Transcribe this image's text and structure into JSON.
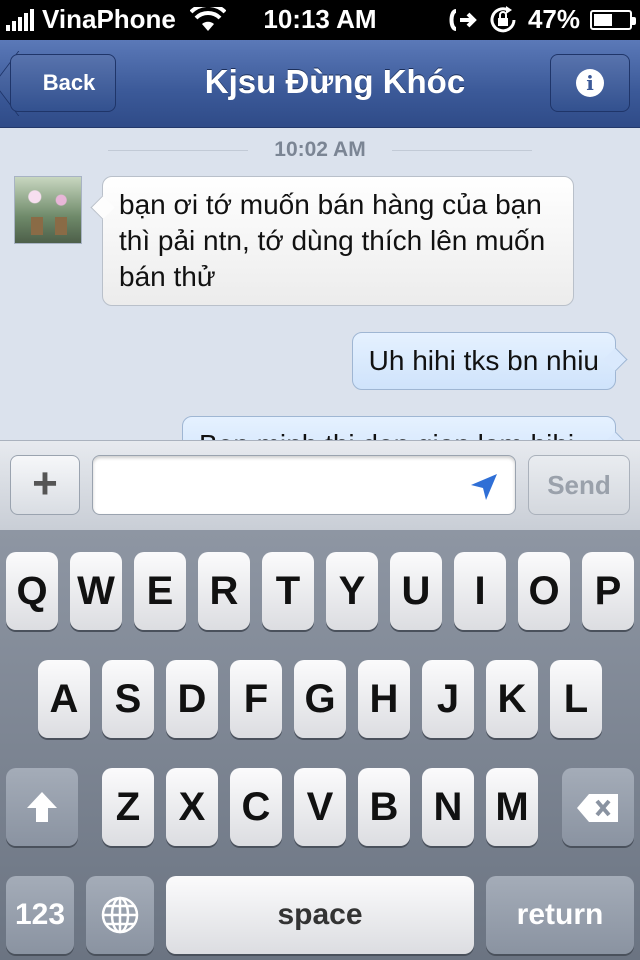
{
  "status_bar": {
    "carrier": "VinaPhone",
    "time": "10:13 AM",
    "battery_percent": "47%",
    "battery_level": 0.47,
    "icons": [
      "signal-icon",
      "wifi-icon",
      "call-forward-icon",
      "rotation-lock-icon",
      "battery-icon"
    ]
  },
  "nav": {
    "back_label": "Back",
    "title": "Kjsu Đừng Khóc",
    "info_icon": "info-icon"
  },
  "chat": {
    "timestamp": "10:02 AM",
    "messages": [
      {
        "direction": "incoming",
        "text": "bạn ơi tớ muốn bán hàng của bạn thì pải ntn, tớ dùng thích lên muốn bán thử"
      },
      {
        "direction": "outgoing",
        "text": "Uh hihi tks bn nhiu"
      },
      {
        "direction": "outgoing",
        "text": "Ben minh thi don gian lam hihi"
      }
    ]
  },
  "compose": {
    "plus_label": "+",
    "input_value": "",
    "send_label": "Send",
    "location_icon": "location-arrow-icon"
  },
  "keyboard": {
    "row1": [
      "Q",
      "W",
      "E",
      "R",
      "T",
      "Y",
      "U",
      "I",
      "O",
      "P"
    ],
    "row2": [
      "A",
      "S",
      "D",
      "F",
      "G",
      "H",
      "J",
      "K",
      "L"
    ],
    "row3": [
      "Z",
      "X",
      "C",
      "V",
      "B",
      "N",
      "M"
    ],
    "numbers_label": "123",
    "space_label": "space",
    "return_label": "return"
  }
}
